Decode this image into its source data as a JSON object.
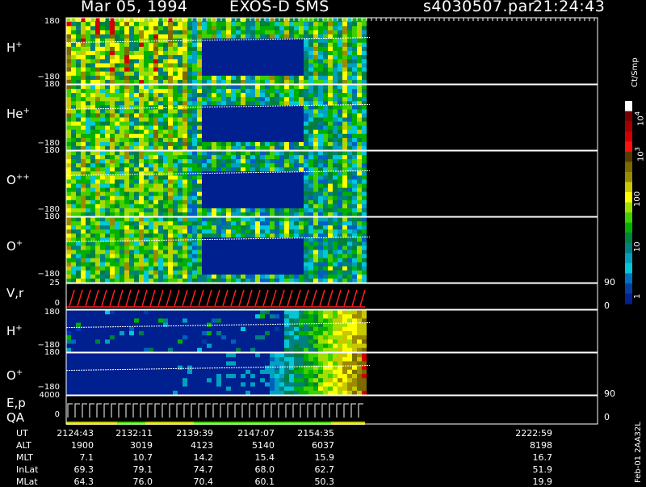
{
  "header": {
    "date": "Mar 05, 1994",
    "instrument": "EXOS-D SMS",
    "file": "s4030507.par",
    "time": "21:24:43"
  },
  "panels": [
    {
      "id": "h_plus_1",
      "label": "H",
      "sup": "+",
      "ytop": "180",
      "ybot": "−180"
    },
    {
      "id": "he_plus",
      "label": "He",
      "sup": "+",
      "ytop": "180",
      "ybot": "−180"
    },
    {
      "id": "o_pp",
      "label": "O",
      "sup": "++",
      "ytop": "180",
      "ybot": "−180"
    },
    {
      "id": "o_plus_1",
      "label": "O",
      "sup": "+",
      "ytop": "180",
      "ybot": "−180"
    },
    {
      "id": "vr",
      "label": "V,r",
      "sup": "",
      "ytop": "25",
      "ybot": "0",
      "rtop": "90",
      "rbot": "0"
    },
    {
      "id": "h_plus_2",
      "label": "H",
      "sup": "+",
      "ytop": "180",
      "ybot": "−180"
    },
    {
      "id": "o_plus_2",
      "label": "O",
      "sup": "+",
      "ytop": "180",
      "ybot": "−180"
    },
    {
      "id": "ep",
      "label": "E,p",
      "label2": "QA",
      "sup": "",
      "ytop": "4000",
      "ybot": "0",
      "rtop": "90",
      "rbot": "0"
    }
  ],
  "colorbar": {
    "title": "Ct/Smp",
    "ticks": [
      {
        "text": "10",
        "exp": "4"
      },
      {
        "text": "10",
        "exp": "3"
      },
      {
        "text": "100",
        "exp": ""
      },
      {
        "text": "10",
        "exp": ""
      },
      {
        "text": "1",
        "exp": ""
      }
    ],
    "colors": [
      "#ffffff",
      "#7a0000",
      "#a00000",
      "#d00000",
      "#ff1010",
      "#5a3a00",
      "#7a6a00",
      "#9a8a00",
      "#c8c800",
      "#ffff00",
      "#a0e000",
      "#40d000",
      "#00b000",
      "#008040",
      "#008080",
      "#00a0c0",
      "#00c8d8",
      "#0070c0",
      "#0040a0",
      "#002090"
    ]
  },
  "footer": {
    "row_labels": [
      "UT",
      "ALT",
      "MLT",
      "InLat",
      "MLat"
    ],
    "columns": [
      [
        "2124:43",
        "1900",
        "7.1",
        "69.3",
        "64.3"
      ],
      [
        "2132:11",
        "3019",
        "10.7",
        "79.1",
        "76.0"
      ],
      [
        "2139:39",
        "4123",
        "14.2",
        "74.7",
        "70.4"
      ],
      [
        "2147:07",
        "5140",
        "15.4",
        "68.0",
        "60.1"
      ],
      [
        "2154:35",
        "6037",
        "15.9",
        "62.7",
        "50.3"
      ],
      [
        "2222:59",
        "8198",
        "16.7",
        "51.9",
        "19.9"
      ]
    ],
    "version": "Feb-01 2AA32L"
  },
  "chart_data": {
    "type": "heatmap",
    "title": "Mar 05, 1994   EXOS-D SMS",
    "time_axis": [
      "2124:43",
      "2132:11",
      "2139:39",
      "2147:07",
      "2154:35",
      "2222:59"
    ],
    "panels": [
      "H+",
      "He+",
      "O++",
      "O+",
      "V,r",
      "H+",
      "O+",
      "E,p QA"
    ],
    "pitch_angle_range": [
      -180,
      180
    ],
    "vr_range": [
      0,
      25
    ],
    "ep_range": [
      0,
      4000
    ],
    "colorbar_unit": "Ct/Smp",
    "colorbar_range": [
      1,
      10000
    ],
    "colorbar_scale": "log"
  }
}
